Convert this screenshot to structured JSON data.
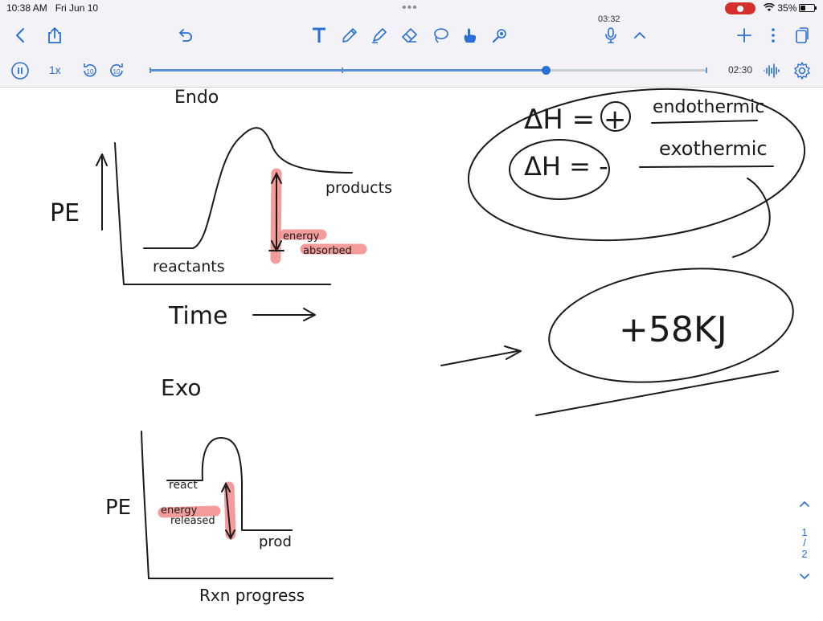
{
  "status": {
    "time": "10:38 AM",
    "date": "Fri Jun 10",
    "battery": "35%",
    "battery_fraction": 0.35
  },
  "toolbar": {
    "recording_time": "03:32"
  },
  "playback": {
    "speed": "1x",
    "elapsed": "02:30",
    "progress_fraction": 0.71,
    "skip_back": "10",
    "skip_forward": "10"
  },
  "notes": {
    "endo_title": "Endo",
    "pe_label_1": "PE",
    "reactants": "reactants",
    "products": "products",
    "energy_absorbed_1": "energy",
    "energy_absorbed_2": "absorbed",
    "time_label": "Time",
    "exo_title": "Exo",
    "pe_label_2": "PE",
    "react": "react",
    "energy_released_1": "energy",
    "energy_released_2": "released",
    "prod": "prod",
    "rxn_progress": "Rxn progress",
    "delta_h_pos": "ΔH = +",
    "endothermic": "endothermic",
    "delta_h_neg": "ΔH = -",
    "exothermic": "exothermic",
    "value": "+58KJ"
  },
  "pager": {
    "current": "1",
    "separator": "/",
    "total": "2"
  },
  "colors": {
    "accent": "#2a6fd6",
    "highlight": "#f28b8b",
    "ink": "#1a1a1a"
  }
}
